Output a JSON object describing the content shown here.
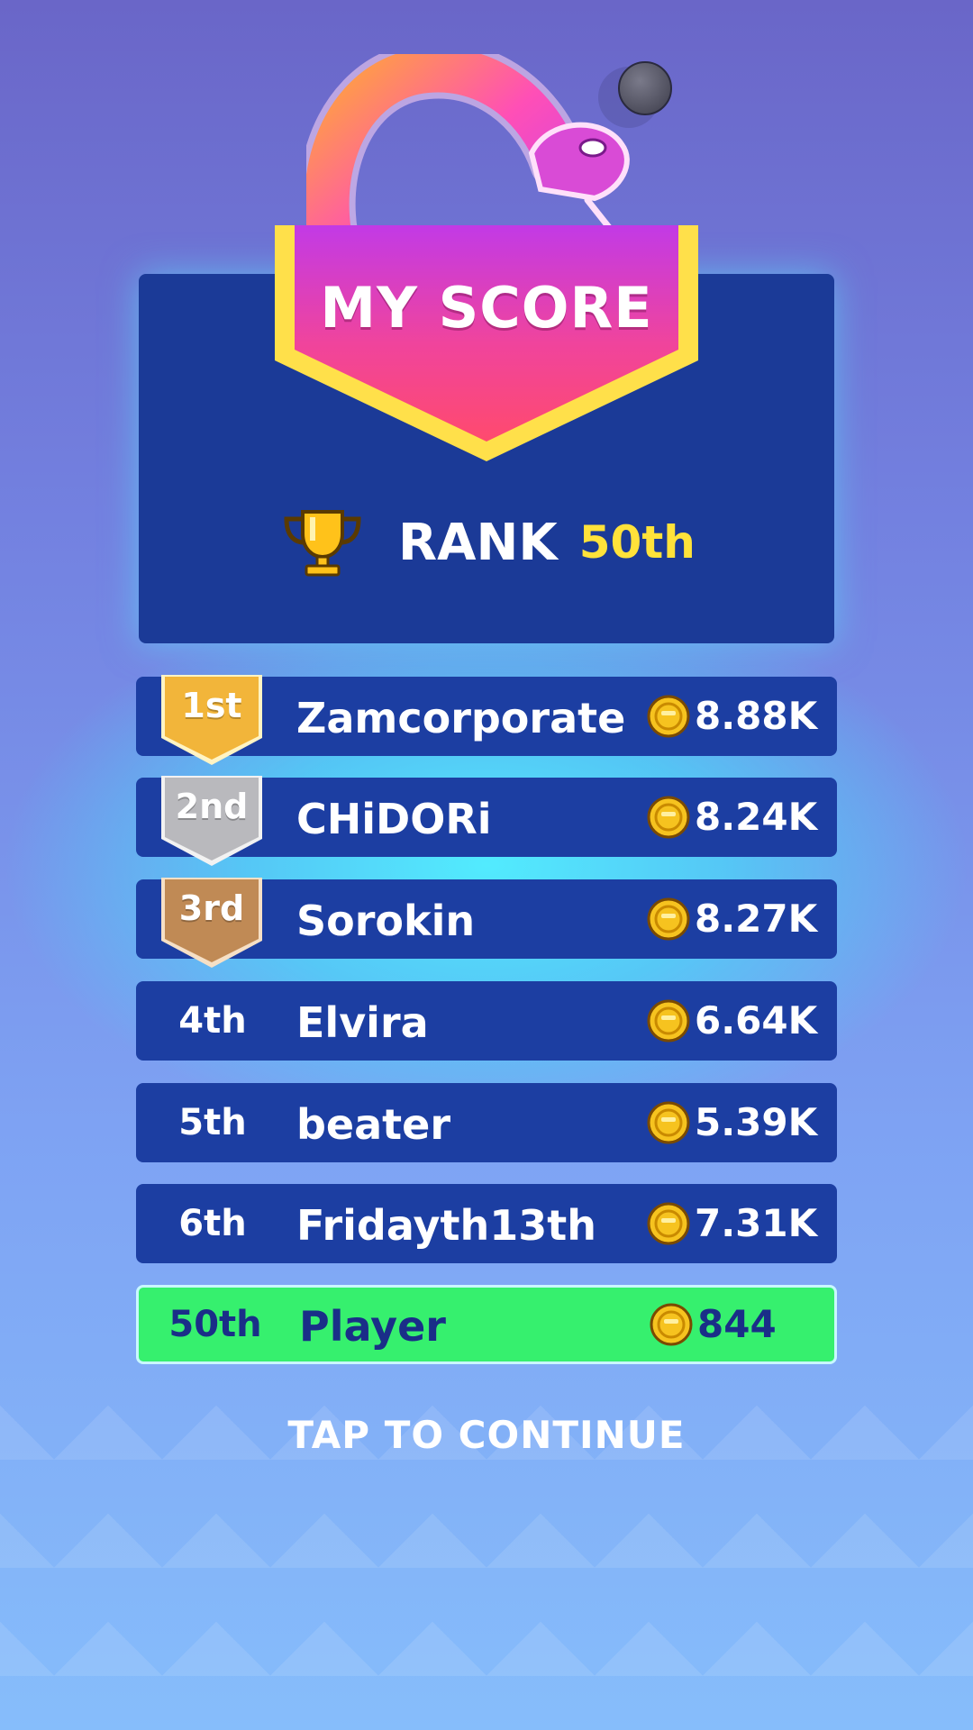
{
  "header": {
    "title": "MY SCORE",
    "rank_label": "RANK",
    "rank_value": "50th"
  },
  "leaderboard": [
    {
      "position": "1st",
      "name": "Zamcorporate",
      "score": "8.88K",
      "medal": "gold"
    },
    {
      "position": "2nd",
      "name": "CHiDORi",
      "score": "8.24K",
      "medal": "silver"
    },
    {
      "position": "3rd",
      "name": "Sorokin",
      "score": "8.27K",
      "medal": "bronze"
    },
    {
      "position": "4th",
      "name": "Elvira",
      "score": "6.64K",
      "medal": ""
    },
    {
      "position": "5th",
      "name": "beater",
      "score": "5.39K",
      "medal": ""
    },
    {
      "position": "6th",
      "name": "Fridayth13th",
      "score": "7.31K",
      "medal": ""
    }
  ],
  "player": {
    "position": "50th",
    "name": "Player",
    "score": "844"
  },
  "footer": {
    "continue_label": "TAP TO CONTINUE"
  },
  "colors": {
    "panel": "#1b3a97",
    "row": "#1c3ea2",
    "player_row": "#36f06e",
    "rank_highlight": "#ffe23a",
    "gold": "#f2b53a",
    "silver": "#b9b9bd",
    "bronze": "#c08a55"
  },
  "icons": [
    "snake-logo-icon",
    "trophy-icon",
    "coin-icon"
  ]
}
